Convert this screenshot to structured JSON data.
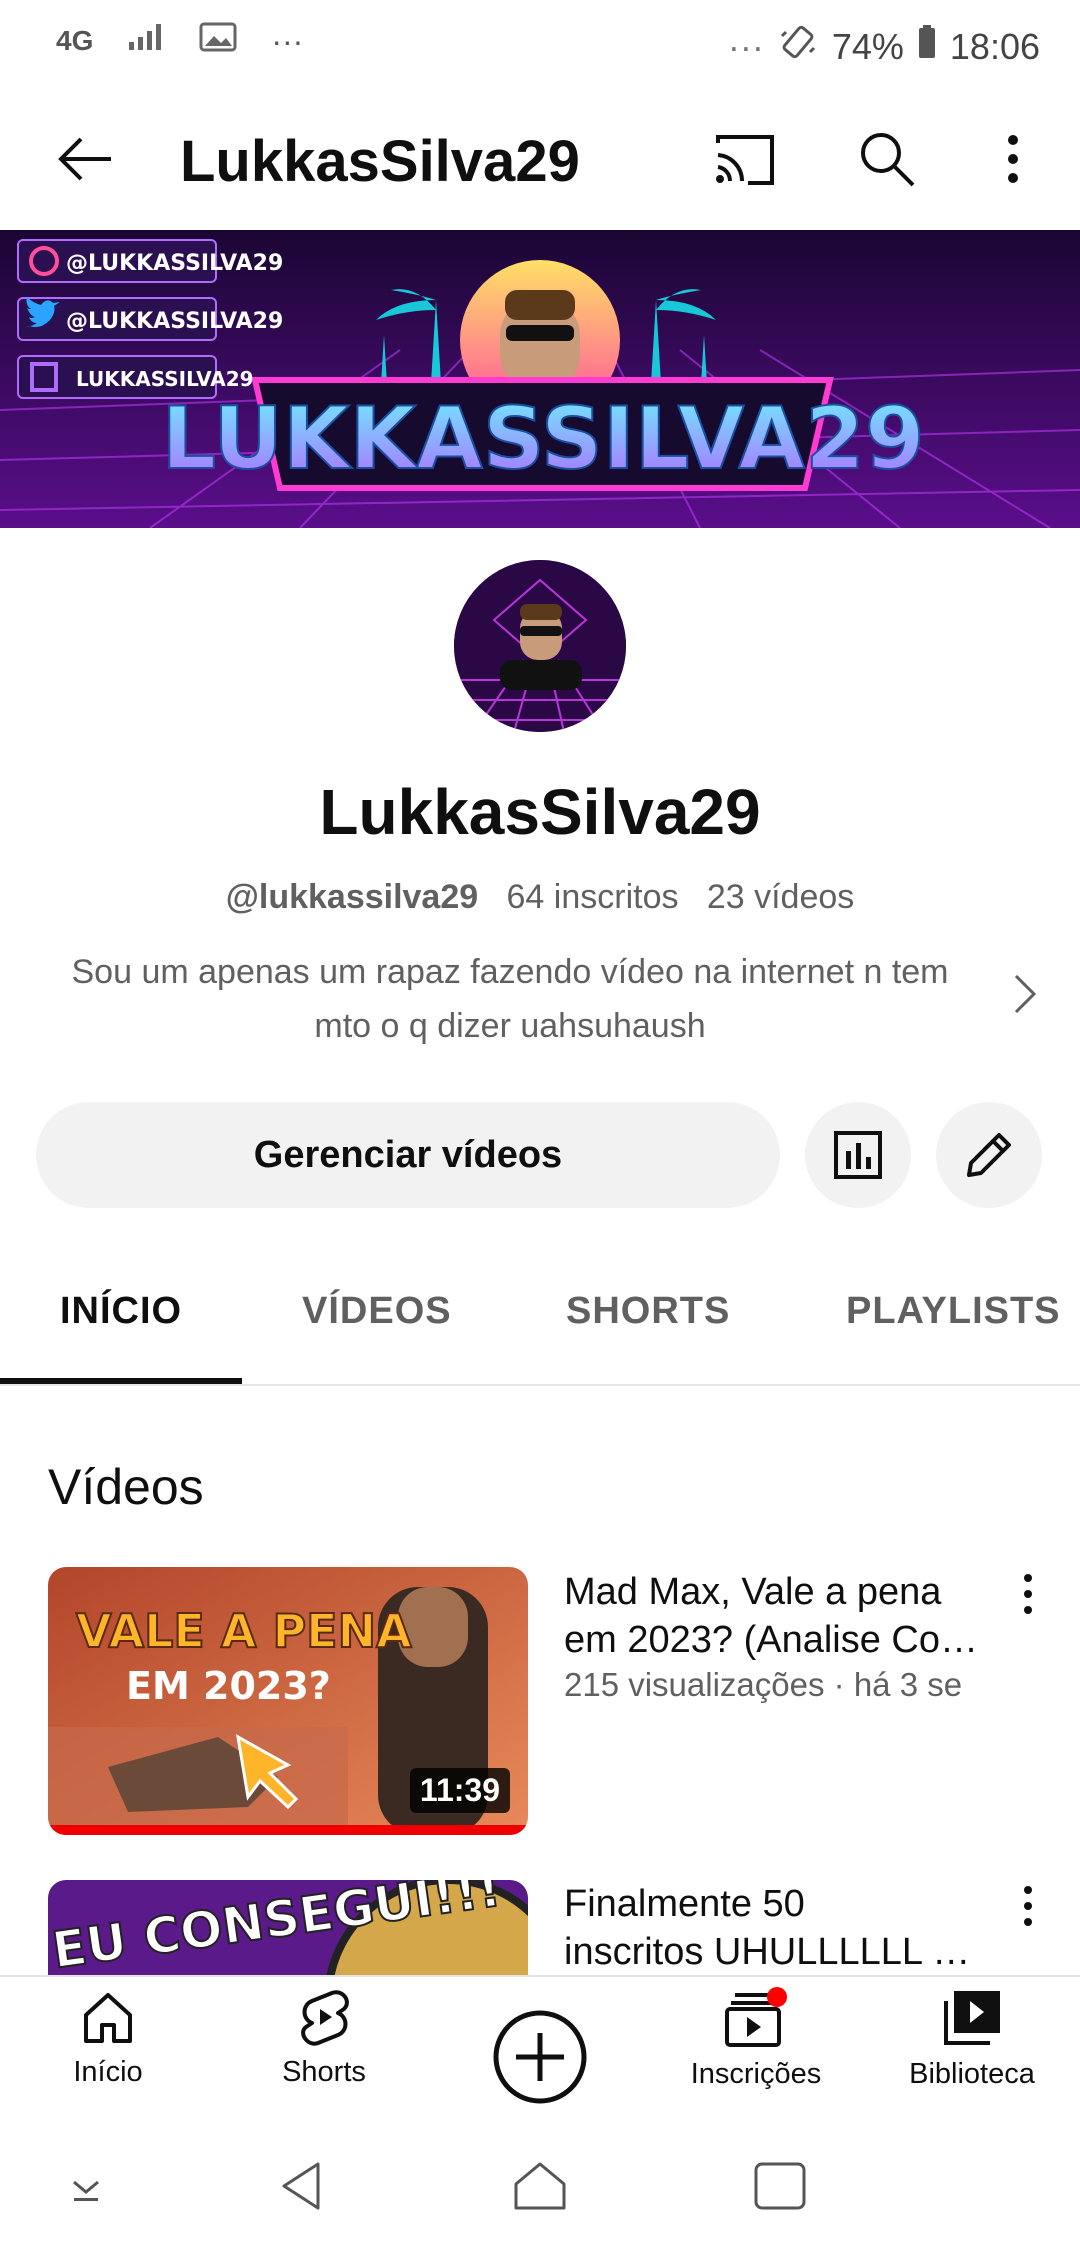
{
  "status_bar": {
    "network": "4G",
    "more": "···",
    "battery": "74%",
    "time": "18:06"
  },
  "app_bar": {
    "title": "LukkasSilva29"
  },
  "banner": {
    "social_1": "@LUKKASSILVA29",
    "social_2": "@LUKKASSILVA29",
    "social_3": "LUKKASSILVA29",
    "logo_text": "LUKKASSILVA29"
  },
  "channel": {
    "name": "LukkasSilva29",
    "handle": "@lukkassilva29",
    "subscribers": "64 inscritos",
    "videos_count": "23 vídeos",
    "description": "Sou um apenas um rapaz fazendo vídeo na internet n tem mto o q dizer uahsuhaush"
  },
  "actions": {
    "manage_label": "Gerenciar vídeos"
  },
  "tabs": [
    "INÍCIO",
    "VÍDEOS",
    "SHORTS",
    "PLAYLISTS"
  ],
  "section": {
    "title": "Vídeos"
  },
  "videos": [
    {
      "title_line1": "Mad Max,  Vale a pena",
      "title_line2": "em 2023? (Analise Co…",
      "meta": "215 visualizações · há 3 se",
      "duration": "11:39",
      "thumb_text_1": "VALE A PENA",
      "thumb_text_2": "EM 2023?"
    },
    {
      "title_line1": "Finalmente 50",
      "title_line2": "inscritos UHULLLLLL …",
      "thumb_text_1": "EU CONSEGUI!!!"
    }
  ],
  "bottom_nav": {
    "home": "Início",
    "shorts": "Shorts",
    "subscriptions": "Inscrições",
    "library": "Biblioteca"
  },
  "colors": {
    "accent_red": "#ff0000",
    "banner_purple": "#2a0845",
    "neon_cyan": "#3ad7ff",
    "neon_pink": "#ff3bd4"
  }
}
